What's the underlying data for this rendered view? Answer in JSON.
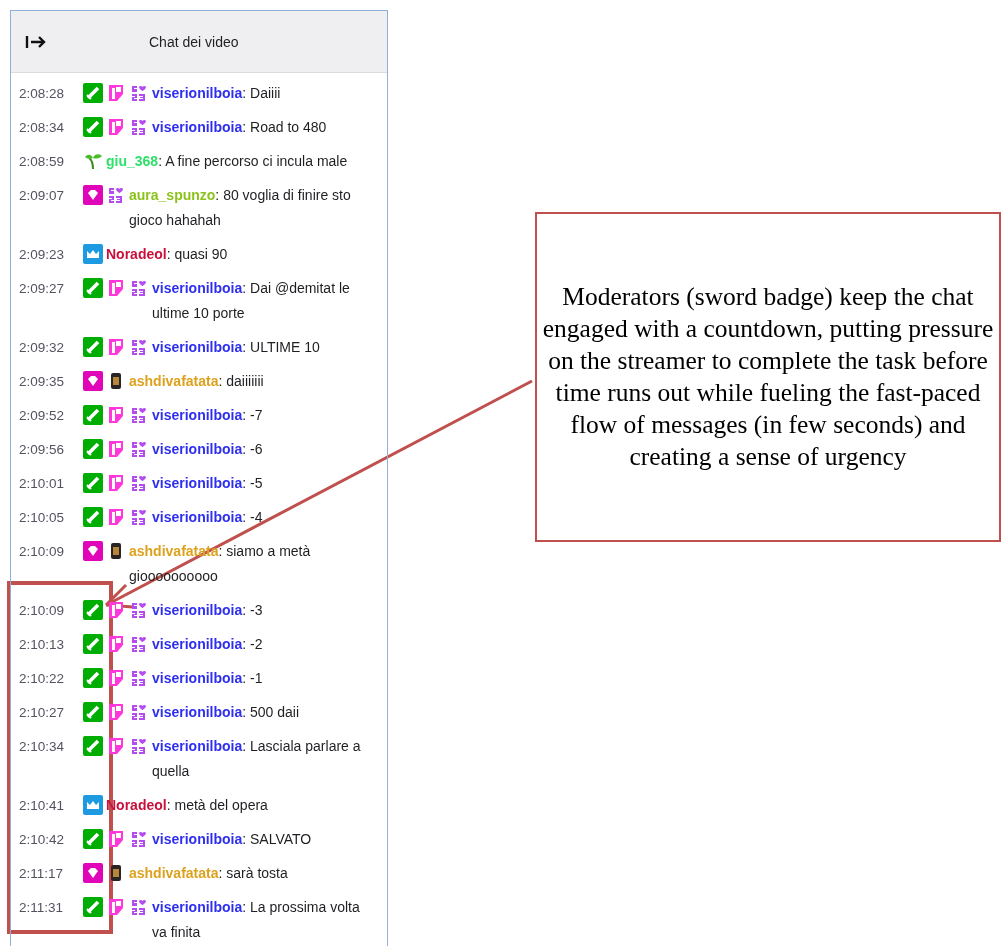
{
  "chat": {
    "title": "Chat dei video",
    "messages": [
      {
        "time": "2:08:28",
        "badges": [
          {
            "kind": "moderator"
          },
          {
            "kind": "first"
          },
          {
            "kind": "anniversary"
          }
        ],
        "user": "viserionilboia",
        "color": "#2e2ef0",
        "text": ": Daiiii"
      },
      {
        "time": "2:08:34",
        "badges": [
          {
            "kind": "moderator"
          },
          {
            "kind": "first"
          },
          {
            "kind": "anniversary"
          }
        ],
        "user": "viserionilboia",
        "color": "#2e2ef0",
        "text": ": Road to 480"
      },
      {
        "time": "2:08:59",
        "badges": [
          {
            "kind": "sprout"
          }
        ],
        "user": "giu_368",
        "color": "#2fe06a",
        "text": ": A fine percorso ci incula male"
      },
      {
        "time": "2:09:07",
        "badges": [
          {
            "kind": "vip"
          },
          {
            "kind": "anniversary"
          }
        ],
        "user": "aura_spunzo",
        "color": "#8cc21c",
        "text": ": 80 voglia di finire sto gioco hahahah"
      },
      {
        "time": "2:09:23",
        "badges": [
          {
            "kind": "crown"
          }
        ],
        "user": "Noradeol",
        "color": "#c8103c",
        "text": ": quasi 90"
      },
      {
        "time": "2:09:27",
        "badges": [
          {
            "kind": "moderator"
          },
          {
            "kind": "first"
          },
          {
            "kind": "anniversary"
          }
        ],
        "user": "viserionilboia",
        "color": "#2e2ef0",
        "text": ": Dai @demitat le ultime 10 porte"
      },
      {
        "time": "2:09:32",
        "badges": [
          {
            "kind": "moderator"
          },
          {
            "kind": "first"
          },
          {
            "kind": "anniversary"
          }
        ],
        "user": "viserionilboia",
        "color": "#2e2ef0",
        "text": ": ULTIME 10"
      },
      {
        "time": "2:09:35",
        "badges": [
          {
            "kind": "vip"
          },
          {
            "kind": "lantern"
          }
        ],
        "user": "ashdivafatata",
        "color": "#dca21e",
        "text": ": daiiiiiii"
      },
      {
        "time": "2:09:52",
        "badges": [
          {
            "kind": "moderator"
          },
          {
            "kind": "first"
          },
          {
            "kind": "anniversary"
          }
        ],
        "user": "viserionilboia",
        "color": "#2e2ef0",
        "text": ": -7"
      },
      {
        "time": "2:09:56",
        "badges": [
          {
            "kind": "moderator"
          },
          {
            "kind": "first"
          },
          {
            "kind": "anniversary"
          }
        ],
        "user": "viserionilboia",
        "color": "#2e2ef0",
        "text": ": -6"
      },
      {
        "time": "2:10:01",
        "badges": [
          {
            "kind": "moderator"
          },
          {
            "kind": "first"
          },
          {
            "kind": "anniversary"
          }
        ],
        "user": "viserionilboia",
        "color": "#2e2ef0",
        "text": ": -5"
      },
      {
        "time": "2:10:05",
        "badges": [
          {
            "kind": "moderator"
          },
          {
            "kind": "first"
          },
          {
            "kind": "anniversary"
          }
        ],
        "user": "viserionilboia",
        "color": "#2e2ef0",
        "text": ": -4"
      },
      {
        "time": "2:10:09",
        "badges": [
          {
            "kind": "vip"
          },
          {
            "kind": "lantern"
          }
        ],
        "user": "ashdivafatata",
        "color": "#dca21e",
        "text": ": siamo a metà gioooooooooo"
      },
      {
        "time": "2:10:09",
        "badges": [
          {
            "kind": "moderator"
          },
          {
            "kind": "first"
          },
          {
            "kind": "anniversary"
          }
        ],
        "user": "viserionilboia",
        "color": "#2e2ef0",
        "text": ": -3"
      },
      {
        "time": "2:10:13",
        "badges": [
          {
            "kind": "moderator"
          },
          {
            "kind": "first"
          },
          {
            "kind": "anniversary"
          }
        ],
        "user": "viserionilboia",
        "color": "#2e2ef0",
        "text": ": -2"
      },
      {
        "time": "2:10:22",
        "badges": [
          {
            "kind": "moderator"
          },
          {
            "kind": "first"
          },
          {
            "kind": "anniversary"
          }
        ],
        "user": "viserionilboia",
        "color": "#2e2ef0",
        "text": ": -1"
      },
      {
        "time": "2:10:27",
        "badges": [
          {
            "kind": "moderator"
          },
          {
            "kind": "first"
          },
          {
            "kind": "anniversary"
          }
        ],
        "user": "viserionilboia",
        "color": "#2e2ef0",
        "text": ": 500 daii"
      },
      {
        "time": "2:10:34",
        "badges": [
          {
            "kind": "moderator"
          },
          {
            "kind": "first"
          },
          {
            "kind": "anniversary"
          }
        ],
        "user": "viserionilboia",
        "color": "#2e2ef0",
        "text": ": Lasciala parlare a quella"
      },
      {
        "time": "2:10:41",
        "badges": [
          {
            "kind": "crown"
          }
        ],
        "user": "Noradeol",
        "color": "#c8103c",
        "text": ": metà del opera"
      },
      {
        "time": "2:10:42",
        "badges": [
          {
            "kind": "moderator"
          },
          {
            "kind": "first"
          },
          {
            "kind": "anniversary"
          }
        ],
        "user": "viserionilboia",
        "color": "#2e2ef0",
        "text": ": SALVATO"
      },
      {
        "time": "2:11:17",
        "badges": [
          {
            "kind": "vip"
          },
          {
            "kind": "lantern"
          }
        ],
        "user": "ashdivafatata",
        "color": "#dca21e",
        "text": ": sarà tosta"
      },
      {
        "time": "2:11:31",
        "badges": [
          {
            "kind": "moderator"
          },
          {
            "kind": "first"
          },
          {
            "kind": "anniversary"
          }
        ],
        "user": "viserionilboia",
        "color": "#2e2ef0",
        "text": ": La prossima volta va finita"
      }
    ]
  },
  "annotation": {
    "text": "Moderators (sword badge) keep the chat engaged with a countdown, putting pressure on the streamer to complete the task before time runs out while fueling the fast-paced flow of messages (in few seconds) and creating a sense of urgency"
  }
}
